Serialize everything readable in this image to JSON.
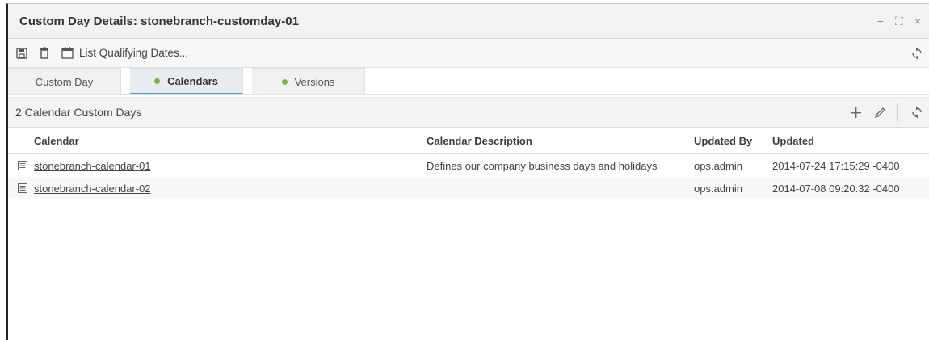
{
  "window": {
    "title": "Custom Day Details: stonebranch-customday-01",
    "controls": [
      "−",
      "⛶",
      "×"
    ]
  },
  "toolbar": {
    "save_icon": "save-icon",
    "delete_icon": "trash-icon",
    "list_label": "List Qualifying Dates...",
    "list_icon": "calendar-icon",
    "refresh_icon": "refresh-icon"
  },
  "tabs": [
    {
      "label": "Custom Day",
      "active": false,
      "dot": false
    },
    {
      "label": "Calendars",
      "active": true,
      "dot": true
    },
    {
      "label": "Versions",
      "active": false,
      "dot": true
    }
  ],
  "section": {
    "title": "2 Calendar Custom Days",
    "actions": [
      "add-icon",
      "edit-icon",
      "refresh-icon"
    ]
  },
  "table": {
    "columns": [
      "Calendar",
      "Calendar Description",
      "Updated By",
      "Updated"
    ],
    "rows": [
      {
        "calendar": "stonebranch-calendar-01",
        "description": "Defines our company business days and holidays",
        "updated_by": "ops.admin",
        "updated": "2014-07-24 17:15:29 -0400"
      },
      {
        "calendar": "stonebranch-calendar-02",
        "description": "",
        "updated_by": "ops.admin",
        "updated": "2014-07-08 09:20:32 -0400"
      }
    ]
  },
  "colors": {
    "accent": "#3aa0d8",
    "dot": "#7cb342"
  }
}
